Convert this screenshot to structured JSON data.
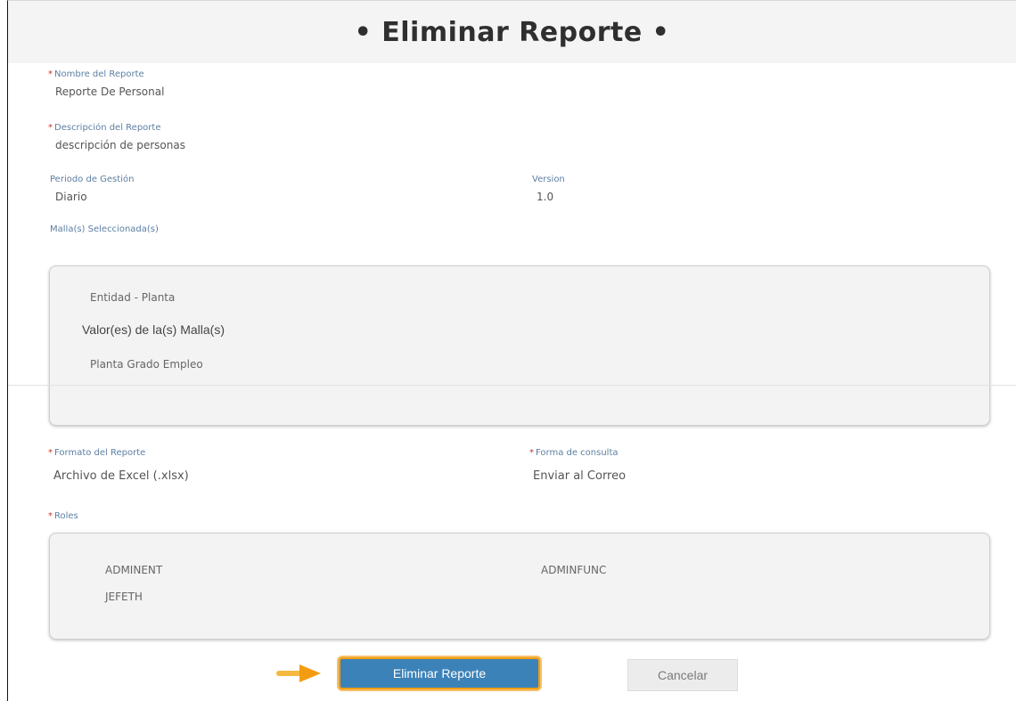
{
  "title": "• Eliminar Reporte •",
  "fields": {
    "report_name": {
      "label": "Nombre del Reporte",
      "value": "Reporte De Personal",
      "required": "*"
    },
    "report_description": {
      "label": "Descripción del Reporte",
      "value": "descripción de personas",
      "required": "*"
    },
    "management_period": {
      "label": "Periodo de Gestión",
      "value": "Diario"
    },
    "version": {
      "label": "Version",
      "value": "1.0"
    },
    "selected_meshes_label": "Malla(s) Seleccionada(s)",
    "report_format": {
      "label": "Formato del Reporte",
      "value": "Archivo de Excel (.xlsx)",
      "required": "*"
    },
    "query_method": {
      "label": "Forma de consulta",
      "value": "Enviar al Correo",
      "required": "*"
    },
    "roles_label": "Roles",
    "roles_required": "*"
  },
  "mesh_panel": {
    "entity": "Entidad - Planta",
    "values_heading": "Valor(es) de la(s) Malla(s)",
    "value_item": "Planta Grado Empleo"
  },
  "roles": [
    "ADMINENT",
    "ADMINFUNC",
    "JEFETH"
  ],
  "buttons": {
    "delete": "Eliminar Reporte",
    "cancel": "Cancelar"
  },
  "colors": {
    "primary_button": "#3b82b8",
    "highlight": "#f39c12",
    "label_blue": "#5c7fa3"
  },
  "icons": {
    "pointer": "arrow-right-icon"
  }
}
